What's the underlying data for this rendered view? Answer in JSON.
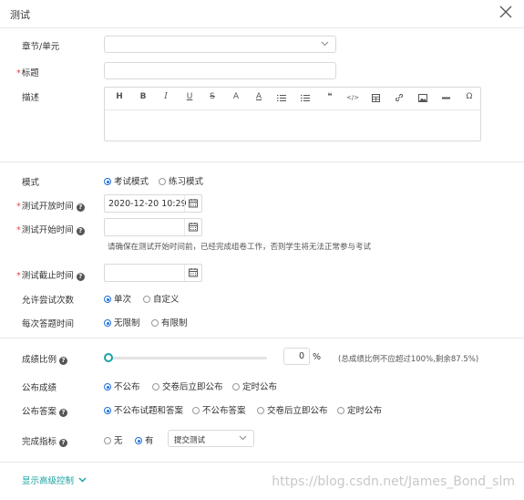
{
  "dialog": {
    "title": "测试"
  },
  "form": {
    "chapter_label": "章节/单元",
    "chapter_value": "",
    "title_label": "标题",
    "title_value": "",
    "desc_label": "描述",
    "toolbar": [
      "H",
      "B",
      "I",
      "U",
      "S",
      "A",
      "A",
      "ol",
      "ul",
      "quote",
      "code",
      "table",
      "link",
      "image",
      "hr",
      "Ω"
    ],
    "mode_label": "模式",
    "mode_options": [
      "考试模式",
      "练习模式"
    ],
    "open_time_label": "测试开放时间",
    "open_time_value": "2020-12-20 10:29",
    "start_time_label": "测试开始时间",
    "start_time_value": "",
    "start_hint": "请确保在测试开始时间前，已经完成组卷工作，否则学生将无法正常参与考试",
    "end_time_label": "测试截止时间",
    "end_time_value": "",
    "attempts_label": "允许尝试次数",
    "attempts_options": [
      "单次",
      "自定义"
    ],
    "answer_time_label": "每次答题时间",
    "answer_time_options": [
      "无限制",
      "有限制"
    ],
    "score_ratio_label": "成绩比例",
    "score_ratio_value": "0",
    "score_ratio_unit": "%",
    "score_ratio_hint": "(总成绩比例不应超过100%,剩余87.5%)",
    "publish_score_label": "公布成绩",
    "publish_score_options": [
      "不公布",
      "交卷后立即公布",
      "定时公布"
    ],
    "publish_answer_label": "公布答案",
    "publish_answer_options": [
      "不公布试题和答案",
      "不公布答案",
      "交卷后立即公布",
      "定时公布"
    ],
    "completion_label": "完成指标",
    "completion_options": [
      "无",
      "有"
    ],
    "completion_select": "提交测试",
    "advanced_link": "显示高级控制"
  },
  "watermark": "https://blog.csdn.net/James_Bond_slm"
}
